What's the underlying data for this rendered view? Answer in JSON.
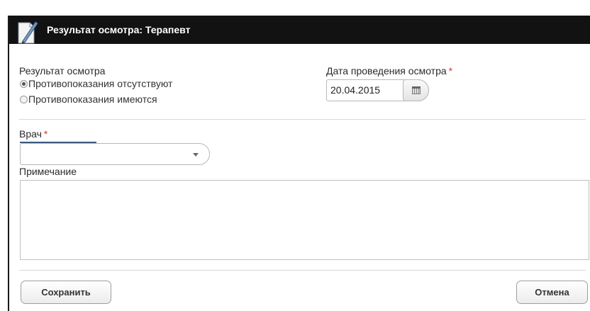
{
  "dialog": {
    "title": "Результат осмотра: Терапевт",
    "title_icon": "pen-document-icon"
  },
  "result": {
    "label": "Результат осмотра",
    "options": [
      {
        "label": "Противопоказания отсутствуют",
        "checked": true
      },
      {
        "label": "Противопоказания имеются",
        "checked": false
      }
    ]
  },
  "date": {
    "label": "Дата проведения осмотра",
    "required_mark": "*",
    "value": "20.04.2015",
    "button_icon": "calendar-icon"
  },
  "doctor": {
    "label": "Врач",
    "required_mark": "*",
    "value": "",
    "dropdown_icon": "chevron-down-icon"
  },
  "note": {
    "label": "Примечание",
    "value": ""
  },
  "buttons": {
    "save": "Сохранить",
    "cancel": "Отмена"
  },
  "colors": {
    "titlebar": "#121212",
    "required": "#e4332c"
  }
}
